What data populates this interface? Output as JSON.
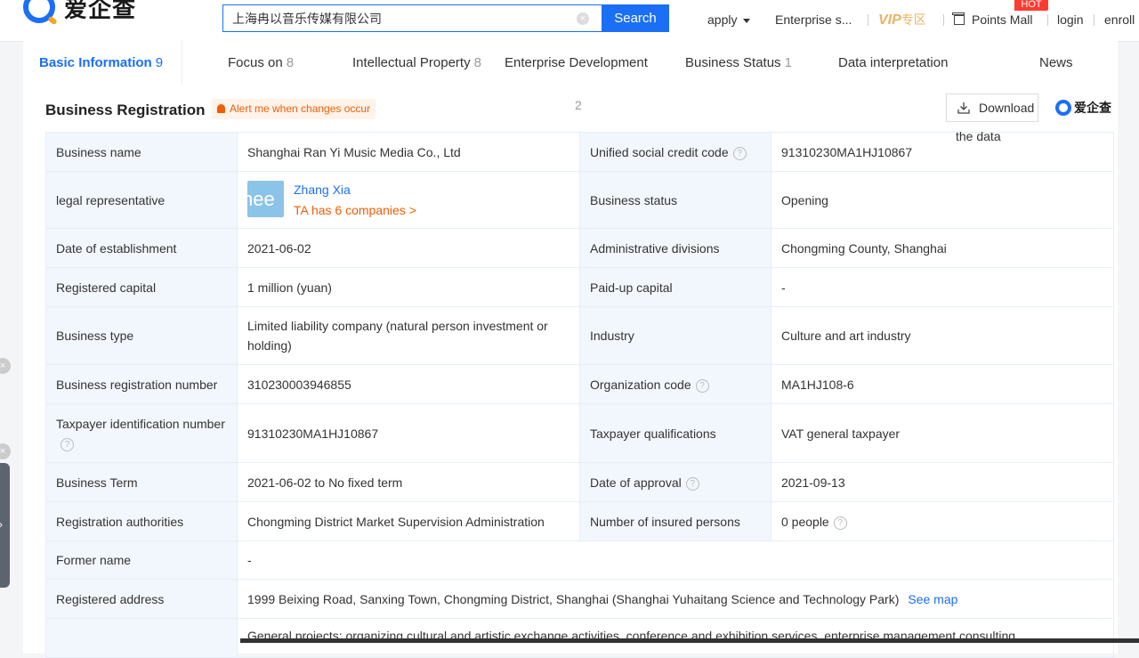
{
  "header": {
    "logo_text": "爱企查",
    "search": {
      "value": "上海冉以音乐传媒有限公司",
      "button": "Search"
    },
    "nav": {
      "apply": "apply",
      "enterprise": "Enterprise s...",
      "vip": "VIP",
      "vip_zone": "专区",
      "hot_badge": "HOT",
      "points_mall": "Points Mall",
      "login": "login",
      "enroll": "enroll"
    }
  },
  "tabs": [
    {
      "label": "Basic Information",
      "count": "9"
    },
    {
      "label": "Focus on",
      "count": "8"
    },
    {
      "label": "Intellectual Property",
      "count": "8"
    },
    {
      "label": "Enterprise Development",
      "count": ""
    },
    {
      "label": "Business Status",
      "count": "1"
    },
    {
      "label": "Data interpretation",
      "count": ""
    },
    {
      "label": "News",
      "count": ""
    }
  ],
  "section": {
    "title": "Business Registration",
    "alert": "Alert me when changes occur",
    "page_num": "2",
    "download": "Download",
    "download_sub": "the data",
    "brand": "爱企查"
  },
  "rows": {
    "business_name": {
      "label": "Business name",
      "value": "Shanghai Ran Yi Music Media Co., Ltd"
    },
    "credit_code": {
      "label": "Unified social credit code",
      "value": "91310230MA1HJ10867"
    },
    "legal_rep": {
      "label": "legal representative",
      "avatar_text": "hee",
      "name": "Zhang Xia",
      "companies": "TA has 6 companies >"
    },
    "business_status": {
      "label": "Business status",
      "value": "Opening"
    },
    "establishment": {
      "label": "Date of establishment",
      "value": "2021-06-02"
    },
    "admin_div": {
      "label": "Administrative divisions",
      "value": "Chongming County, Shanghai"
    },
    "reg_capital": {
      "label": "Registered capital",
      "value": "1 million (yuan)"
    },
    "paid_capital": {
      "label": "Paid-up capital",
      "value": "-"
    },
    "business_type": {
      "label": "Business type",
      "value": "Limited liability company (natural person investment or holding)"
    },
    "industry": {
      "label": "Industry",
      "value": "Culture and art industry"
    },
    "reg_number": {
      "label": "Business registration number",
      "value": "310230003946855"
    },
    "org_code": {
      "label": "Organization code",
      "value": "MA1HJ108-6"
    },
    "taxpayer_id": {
      "label": "Taxpayer identification number",
      "value": "91310230MA1HJ10867"
    },
    "taxpayer_qual": {
      "label": "Taxpayer qualifications",
      "value": "VAT general taxpayer"
    },
    "term": {
      "label": "Business Term",
      "value": "2021-06-02 to No fixed term"
    },
    "approval": {
      "label": "Date of approval",
      "value": "2021-09-13"
    },
    "authority": {
      "label": "Registration authorities",
      "value": "Chongming District Market Supervision Administration"
    },
    "insured": {
      "label": "Number of insured persons",
      "value": "0 people"
    },
    "former_name": {
      "label": "Former name",
      "value": "-"
    },
    "address": {
      "label": "Registered address",
      "value": "1999 Beixing Road, Sanxing Town, Chongming District, Shanghai (Shanghai Yuhaitang Science and Technology Park)",
      "link": "See map"
    },
    "scope": {
      "value": "General projects: organizing cultural and artistic exchange activities, conference and exhibition services, enterprise management consulting"
    }
  }
}
